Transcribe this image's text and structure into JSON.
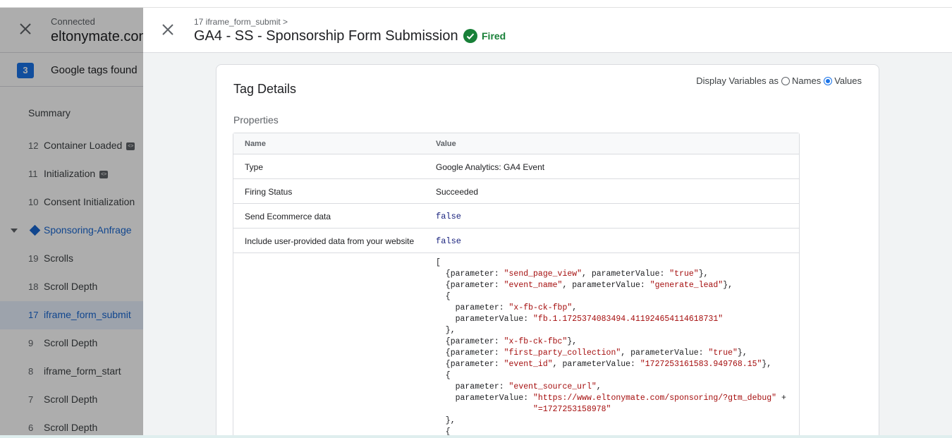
{
  "left": {
    "connected_label": "Connected",
    "domain": "eltonymate.com",
    "tags_found_count": "3",
    "tags_found_label": "Google tags found",
    "summary_label": "Summary",
    "events": [
      {
        "num": "12",
        "label": "Container Loaded",
        "code_icon": true
      },
      {
        "num": "11",
        "label": "Initialization",
        "code_icon": true
      },
      {
        "num": "10",
        "label": "Consent Initialization",
        "code_icon": false
      },
      {
        "num": "",
        "label": "Sponsoring-Anfrage",
        "group": true
      },
      {
        "num": "19",
        "label": "Scrolls"
      },
      {
        "num": "18",
        "label": "Scroll Depth"
      },
      {
        "num": "17",
        "label": "iframe_form_submit",
        "selected": true
      },
      {
        "num": "9",
        "label": "Scroll Depth"
      },
      {
        "num": "8",
        "label": "iframe_form_start"
      },
      {
        "num": "7",
        "label": "Scroll Depth"
      },
      {
        "num": "6",
        "label": "Scroll Depth"
      }
    ]
  },
  "header": {
    "breadcrumb": "17 iframe_form_submit >",
    "title": "GA4 - SS - Sponsorship Form Submission",
    "status": "Fired"
  },
  "card": {
    "title": "Tag Details",
    "display_variables_label": "Display Variables as",
    "option_names": "Names",
    "option_values": "Values",
    "selected_option": "Values",
    "properties_label": "Properties",
    "table": {
      "headers": [
        "Name",
        "Value"
      ],
      "rows": [
        {
          "name": "Type",
          "value": "Google Analytics: GA4 Event"
        },
        {
          "name": "Firing Status",
          "value": "Succeeded"
        },
        {
          "name": "Send Ecommerce data",
          "value": "false"
        },
        {
          "name": "Include user-provided data from your website",
          "value": "false"
        }
      ],
      "event_parameters_code": [
        "[",
        "  {parameter: \"send_page_view\", parameterValue: \"true\"},",
        "  {parameter: \"event_name\", parameterValue: \"generate_lead\"},",
        "  {",
        "    parameter: \"x-fb-ck-fbp\",",
        "    parameterValue: \"fb.1.1725374083494.411924654114618731\"",
        "  },",
        "  {parameter: \"x-fb-ck-fbc\"},",
        "  {parameter: \"first_party_collection\", parameterValue: \"true\"},",
        "  {parameter: \"event_id\", parameterValue: \"1727253161583.949768.15\"},",
        "  {",
        "    parameter: \"event_source_url\",",
        "    parameterValue: \"https://www.eltonymate.com/sponsoring/?gtm_debug\" +",
        "                    \"=1727253158978\"",
        "  },",
        "  {"
      ]
    }
  },
  "colors": {
    "accent": "#1a73e8",
    "fired": "#188038",
    "string": "#a50e0e"
  }
}
